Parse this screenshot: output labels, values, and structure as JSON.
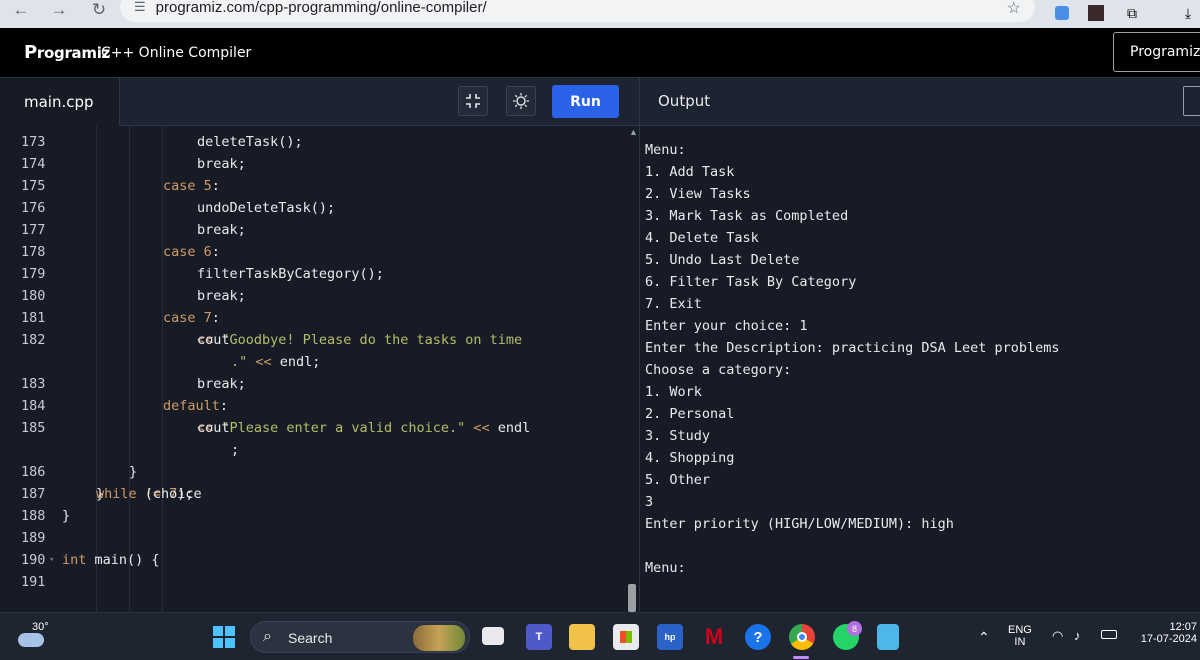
{
  "browser": {
    "url": "programiz.com/cpp-programming/online-compiler/",
    "back_icon": "arrow-left-icon",
    "forward_icon": "arrow-right-icon",
    "reload_icon": "reload-icon"
  },
  "header": {
    "logo_initial": "P",
    "logo_rest": "rogramiz",
    "title": "C++ Online Compiler",
    "pro_button": "Programiz"
  },
  "toolbar": {
    "file_tab": "main.cpp",
    "run_label": "Run",
    "output_label": "Output",
    "fullscreen_glyph": "⛶",
    "theme_glyph": "☼"
  },
  "editor": {
    "lines": [
      {
        "n": "173",
        "indent": 4,
        "parts": [
          {
            "t": "deleteTask();",
            "c": "code"
          }
        ]
      },
      {
        "n": "174",
        "indent": 4,
        "parts": [
          {
            "t": "break;",
            "c": "code"
          }
        ]
      },
      {
        "n": "175",
        "indent": 3,
        "parts": [
          {
            "t": "case ",
            "c": "kw"
          },
          {
            "t": "5",
            "c": "num"
          },
          {
            "t": ":",
            "c": "code"
          }
        ]
      },
      {
        "n": "176",
        "indent": 4,
        "parts": [
          {
            "t": "undoDeleteTask();",
            "c": "code"
          }
        ]
      },
      {
        "n": "177",
        "indent": 4,
        "parts": [
          {
            "t": "break;",
            "c": "code"
          }
        ]
      },
      {
        "n": "178",
        "indent": 3,
        "parts": [
          {
            "t": "case ",
            "c": "kw"
          },
          {
            "t": "6",
            "c": "num"
          },
          {
            "t": ":",
            "c": "code"
          }
        ]
      },
      {
        "n": "179",
        "indent": 4,
        "parts": [
          {
            "t": "filterTaskByCategory();",
            "c": "code"
          }
        ]
      },
      {
        "n": "180",
        "indent": 4,
        "parts": [
          {
            "t": "break;",
            "c": "code"
          }
        ]
      },
      {
        "n": "181",
        "indent": 3,
        "parts": [
          {
            "t": "case ",
            "c": "kw"
          },
          {
            "t": "7",
            "c": "num"
          },
          {
            "t": ":",
            "c": "code"
          }
        ]
      },
      {
        "n": "182",
        "indent": 4,
        "parts": [
          {
            "t": "cout ",
            "c": "code"
          },
          {
            "t": "<< ",
            "c": "kw"
          },
          {
            "t": "\"Goodbye! Please do the tasks on time",
            "c": "str"
          }
        ]
      },
      {
        "n": "",
        "indent": 5,
        "parts": [
          {
            "t": ".\" ",
            "c": "str"
          },
          {
            "t": "<< ",
            "c": "kw"
          },
          {
            "t": "endl;",
            "c": "code"
          }
        ]
      },
      {
        "n": "183",
        "indent": 4,
        "parts": [
          {
            "t": "break;",
            "c": "code"
          }
        ]
      },
      {
        "n": "184",
        "indent": 3,
        "parts": [
          {
            "t": "default",
            "c": "kw"
          },
          {
            "t": ":",
            "c": "code"
          }
        ]
      },
      {
        "n": "185",
        "indent": 4,
        "parts": [
          {
            "t": "cout ",
            "c": "code"
          },
          {
            "t": "<< ",
            "c": "kw"
          },
          {
            "t": "\"Please enter a valid choice.\" ",
            "c": "str"
          },
          {
            "t": "<< ",
            "c": "kw"
          },
          {
            "t": "endl",
            "c": "code"
          }
        ]
      },
      {
        "n": "",
        "indent": 5,
        "parts": [
          {
            "t": ";",
            "c": "code"
          }
        ]
      },
      {
        "n": "186",
        "indent": 2,
        "parts": [
          {
            "t": "}",
            "c": "code"
          }
        ]
      },
      {
        "n": "187",
        "indent": 1,
        "parts": [
          {
            "t": "} ",
            "c": "code"
          },
          {
            "t": "while ",
            "c": "kw"
          },
          {
            "t": "(choice ",
            "c": "code"
          },
          {
            "t": "!= ",
            "c": "kw"
          },
          {
            "t": "7",
            "c": "num"
          },
          {
            "t": ");",
            "c": "code"
          }
        ]
      },
      {
        "n": "188",
        "indent": 0,
        "parts": [
          {
            "t": "}",
            "c": "code"
          }
        ]
      },
      {
        "n": "189",
        "indent": 0,
        "parts": []
      },
      {
        "n": "190",
        "indent": 0,
        "parts": [
          {
            "t": "int ",
            "c": "kw"
          },
          {
            "t": "main() {",
            "c": "code"
          }
        ]
      },
      {
        "n": "191",
        "indent": 0,
        "parts": []
      }
    ]
  },
  "output": {
    "lines": [
      "Menu:",
      "1. Add Task",
      "2. View Tasks",
      "3. Mark Task as Completed",
      "4. Delete Task",
      "5. Undo Last Delete",
      "6. Filter Task By Category",
      "7. Exit",
      "Enter your choice: 1",
      "Enter the Description: practicing DSA Leet problems",
      "Choose a category:",
      "1. Work",
      "2. Personal",
      "3. Study",
      "4. Shopping",
      "5. Other",
      "3",
      "Enter priority (HIGH/LOW/MEDIUM): high",
      "",
      "Menu:"
    ]
  },
  "taskbar": {
    "temperature": "30°",
    "search_label": "Search",
    "language_line1": "ENG",
    "language_line2": "IN",
    "time": "12:07",
    "date": "17-07-2024",
    "whatsapp_badge": "8",
    "icons": [
      "start-icon",
      "search-icon",
      "task-view-icon",
      "teams-icon",
      "file-explorer-icon",
      "store-icon",
      "hp-icon",
      "mcafee-icon",
      "help-icon",
      "chrome-icon",
      "whatsapp-icon",
      "notepad-icon"
    ]
  },
  "colors": {
    "run_button": "#2a62e8",
    "editor_bg": "#161b26",
    "keyword": "#d19a66",
    "string": "#b5bd68"
  }
}
